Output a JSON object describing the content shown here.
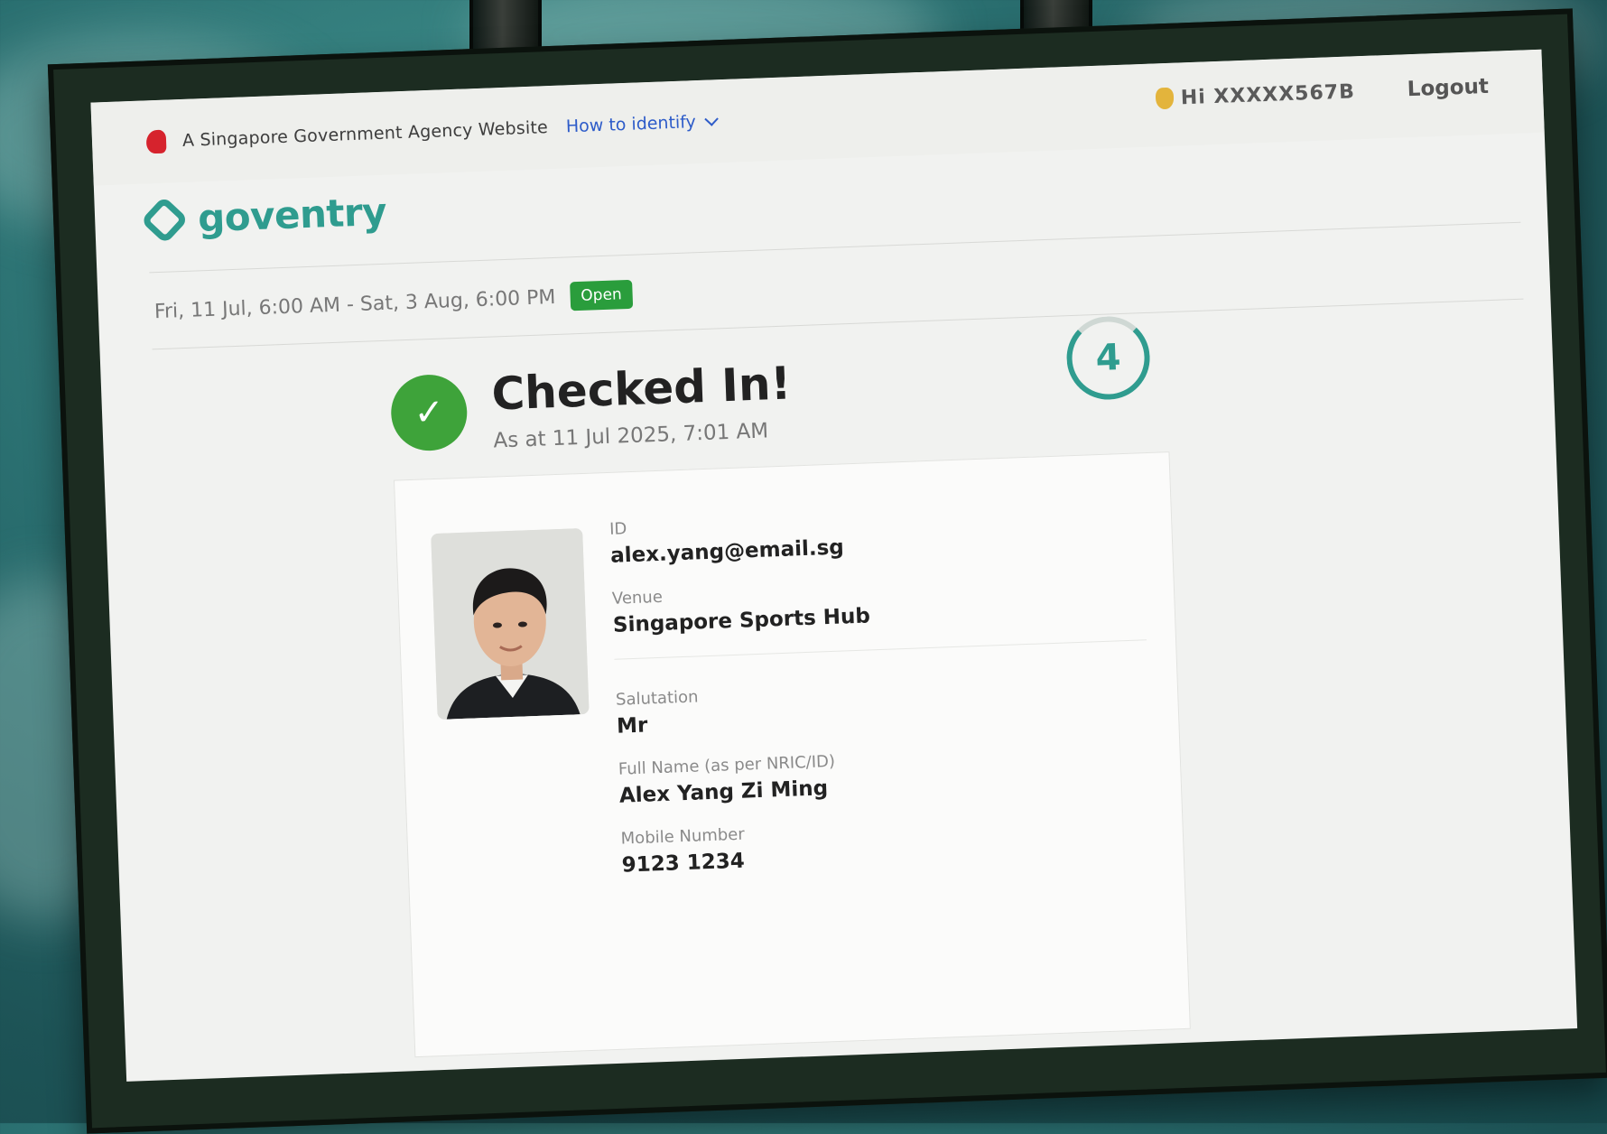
{
  "masthead": {
    "gov_text": "A Singapore Government Agency Website",
    "identify_link": "How to identify"
  },
  "user": {
    "greeting": "Hi XXXXX567B",
    "logout": "Logout"
  },
  "brand": {
    "name": "goventry"
  },
  "event": {
    "dates": "Fri, 11 Jul, 6:00 AM - Sat, 3 Aug, 6:00 PM",
    "status": "Open"
  },
  "checkin": {
    "title": "Checked In!",
    "timestamp": "As at 11 Jul 2025, 7:01 AM",
    "countdown": "4"
  },
  "details": {
    "id_label": "ID",
    "id_value": "alex.yang@email.sg",
    "venue_label": "Venue",
    "venue_value": "Singapore Sports Hub",
    "salutation_label": "Salutation",
    "salutation_value": "Mr",
    "fullname_label": "Full Name (as per NRIC/ID)",
    "fullname_value": "Alex Yang Zi Ming",
    "mobile_label": "Mobile Number",
    "mobile_value": "9123 1234"
  },
  "colors": {
    "brand_teal": "#2f9c8f",
    "success_green": "#3ea33a",
    "badge_green": "#2a9d3c",
    "gov_red": "#d6232d",
    "link_blue": "#2e5cc9"
  }
}
